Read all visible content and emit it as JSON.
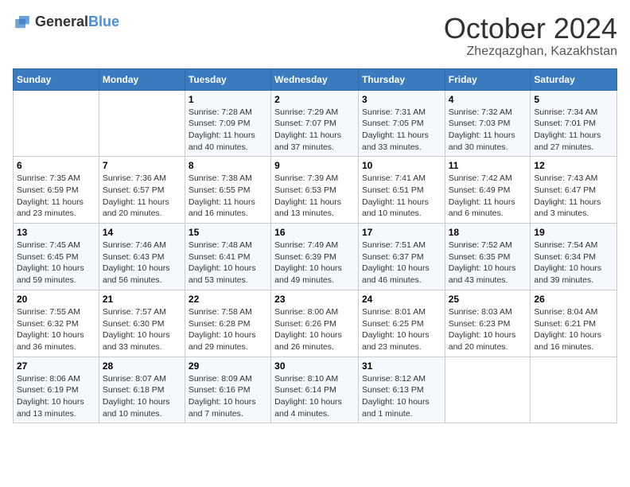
{
  "logo": {
    "general": "General",
    "blue": "Blue"
  },
  "title": {
    "month": "October 2024",
    "location": "Zhezqazghan, Kazakhstan"
  },
  "headers": [
    "Sunday",
    "Monday",
    "Tuesday",
    "Wednesday",
    "Thursday",
    "Friday",
    "Saturday"
  ],
  "weeks": [
    [
      {
        "day": "",
        "info": ""
      },
      {
        "day": "",
        "info": ""
      },
      {
        "day": "1",
        "info": "Sunrise: 7:28 AM\nSunset: 7:09 PM\nDaylight: 11 hours and 40 minutes."
      },
      {
        "day": "2",
        "info": "Sunrise: 7:29 AM\nSunset: 7:07 PM\nDaylight: 11 hours and 37 minutes."
      },
      {
        "day": "3",
        "info": "Sunrise: 7:31 AM\nSunset: 7:05 PM\nDaylight: 11 hours and 33 minutes."
      },
      {
        "day": "4",
        "info": "Sunrise: 7:32 AM\nSunset: 7:03 PM\nDaylight: 11 hours and 30 minutes."
      },
      {
        "day": "5",
        "info": "Sunrise: 7:34 AM\nSunset: 7:01 PM\nDaylight: 11 hours and 27 minutes."
      }
    ],
    [
      {
        "day": "6",
        "info": "Sunrise: 7:35 AM\nSunset: 6:59 PM\nDaylight: 11 hours and 23 minutes."
      },
      {
        "day": "7",
        "info": "Sunrise: 7:36 AM\nSunset: 6:57 PM\nDaylight: 11 hours and 20 minutes."
      },
      {
        "day": "8",
        "info": "Sunrise: 7:38 AM\nSunset: 6:55 PM\nDaylight: 11 hours and 16 minutes."
      },
      {
        "day": "9",
        "info": "Sunrise: 7:39 AM\nSunset: 6:53 PM\nDaylight: 11 hours and 13 minutes."
      },
      {
        "day": "10",
        "info": "Sunrise: 7:41 AM\nSunset: 6:51 PM\nDaylight: 11 hours and 10 minutes."
      },
      {
        "day": "11",
        "info": "Sunrise: 7:42 AM\nSunset: 6:49 PM\nDaylight: 11 hours and 6 minutes."
      },
      {
        "day": "12",
        "info": "Sunrise: 7:43 AM\nSunset: 6:47 PM\nDaylight: 11 hours and 3 minutes."
      }
    ],
    [
      {
        "day": "13",
        "info": "Sunrise: 7:45 AM\nSunset: 6:45 PM\nDaylight: 10 hours and 59 minutes."
      },
      {
        "day": "14",
        "info": "Sunrise: 7:46 AM\nSunset: 6:43 PM\nDaylight: 10 hours and 56 minutes."
      },
      {
        "day": "15",
        "info": "Sunrise: 7:48 AM\nSunset: 6:41 PM\nDaylight: 10 hours and 53 minutes."
      },
      {
        "day": "16",
        "info": "Sunrise: 7:49 AM\nSunset: 6:39 PM\nDaylight: 10 hours and 49 minutes."
      },
      {
        "day": "17",
        "info": "Sunrise: 7:51 AM\nSunset: 6:37 PM\nDaylight: 10 hours and 46 minutes."
      },
      {
        "day": "18",
        "info": "Sunrise: 7:52 AM\nSunset: 6:35 PM\nDaylight: 10 hours and 43 minutes."
      },
      {
        "day": "19",
        "info": "Sunrise: 7:54 AM\nSunset: 6:34 PM\nDaylight: 10 hours and 39 minutes."
      }
    ],
    [
      {
        "day": "20",
        "info": "Sunrise: 7:55 AM\nSunset: 6:32 PM\nDaylight: 10 hours and 36 minutes."
      },
      {
        "day": "21",
        "info": "Sunrise: 7:57 AM\nSunset: 6:30 PM\nDaylight: 10 hours and 33 minutes."
      },
      {
        "day": "22",
        "info": "Sunrise: 7:58 AM\nSunset: 6:28 PM\nDaylight: 10 hours and 29 minutes."
      },
      {
        "day": "23",
        "info": "Sunrise: 8:00 AM\nSunset: 6:26 PM\nDaylight: 10 hours and 26 minutes."
      },
      {
        "day": "24",
        "info": "Sunrise: 8:01 AM\nSunset: 6:25 PM\nDaylight: 10 hours and 23 minutes."
      },
      {
        "day": "25",
        "info": "Sunrise: 8:03 AM\nSunset: 6:23 PM\nDaylight: 10 hours and 20 minutes."
      },
      {
        "day": "26",
        "info": "Sunrise: 8:04 AM\nSunset: 6:21 PM\nDaylight: 10 hours and 16 minutes."
      }
    ],
    [
      {
        "day": "27",
        "info": "Sunrise: 8:06 AM\nSunset: 6:19 PM\nDaylight: 10 hours and 13 minutes."
      },
      {
        "day": "28",
        "info": "Sunrise: 8:07 AM\nSunset: 6:18 PM\nDaylight: 10 hours and 10 minutes."
      },
      {
        "day": "29",
        "info": "Sunrise: 8:09 AM\nSunset: 6:16 PM\nDaylight: 10 hours and 7 minutes."
      },
      {
        "day": "30",
        "info": "Sunrise: 8:10 AM\nSunset: 6:14 PM\nDaylight: 10 hours and 4 minutes."
      },
      {
        "day": "31",
        "info": "Sunrise: 8:12 AM\nSunset: 6:13 PM\nDaylight: 10 hours and 1 minute."
      },
      {
        "day": "",
        "info": ""
      },
      {
        "day": "",
        "info": ""
      }
    ]
  ]
}
